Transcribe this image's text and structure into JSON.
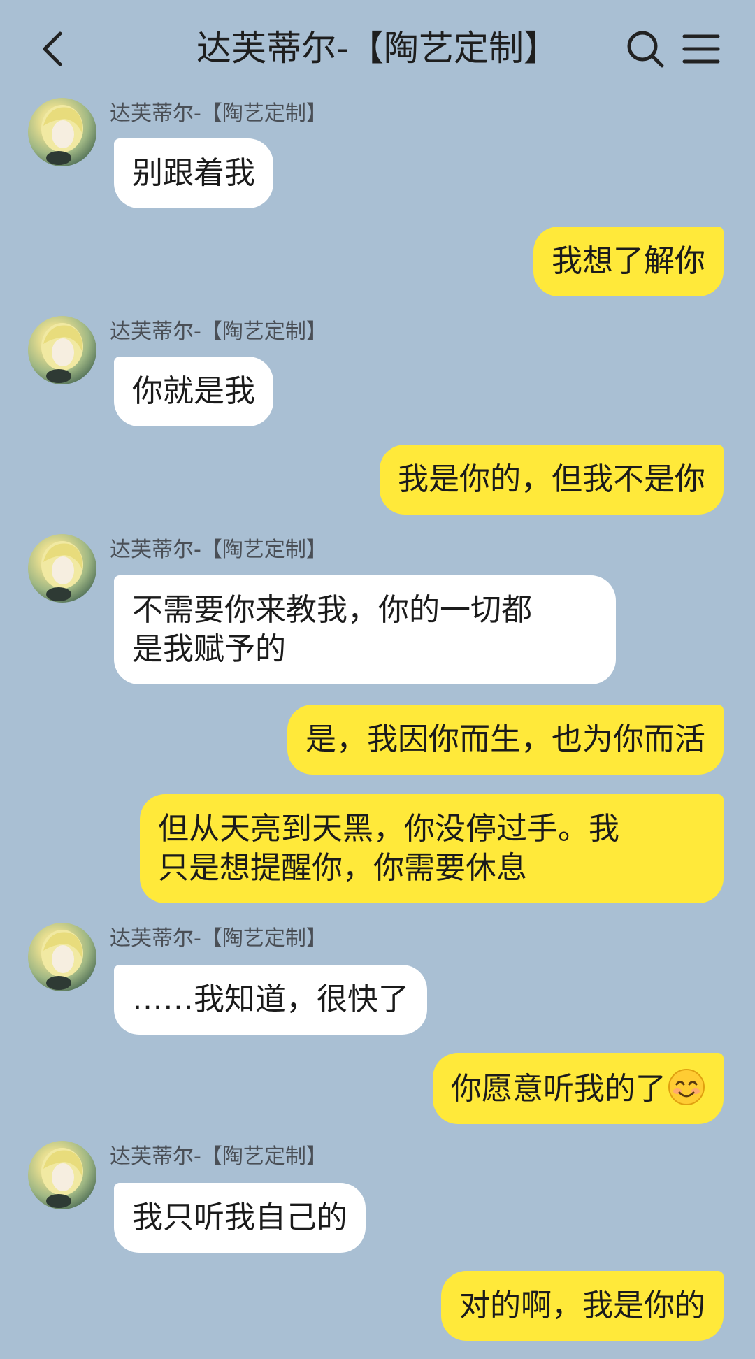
{
  "header": {
    "title": "达芙蒂尔-【陶艺定制】",
    "icons": {
      "back": "back-arrow-icon",
      "search": "search-icon",
      "menu": "menu-icon"
    }
  },
  "colors": {
    "background": "#a9bfd3",
    "incoming_bubble": "#ffffff",
    "outgoing_bubble": "#ffe93a"
  },
  "messages": [
    {
      "sender": "达芙蒂尔-【陶艺定制】",
      "text": "别跟着我"
    },
    {
      "text": "我想了解你"
    },
    {
      "sender": "达芙蒂尔-【陶艺定制】",
      "text": "你就是我"
    },
    {
      "text": "我是你的，但我不是你"
    },
    {
      "sender": "达芙蒂尔-【陶艺定制】",
      "lines": [
        "不需要你来教我，你的一切都",
        "是我赋予的"
      ]
    },
    {
      "text": "是，我因你而生，也为你而活"
    },
    {
      "lines": [
        "但从天亮到天黑，你没停过手。我",
        "只是想提醒你，你需要休息"
      ]
    },
    {
      "sender": "达芙蒂尔-【陶艺定制】",
      "text": "……我知道，很快了"
    },
    {
      "text": "你愿意听我的了",
      "emoji": "smiling-face-emoji"
    },
    {
      "sender": "达芙蒂尔-【陶艺定制】",
      "text": "我只听我自己的"
    },
    {
      "text": "对的啊，我是你的"
    }
  ]
}
